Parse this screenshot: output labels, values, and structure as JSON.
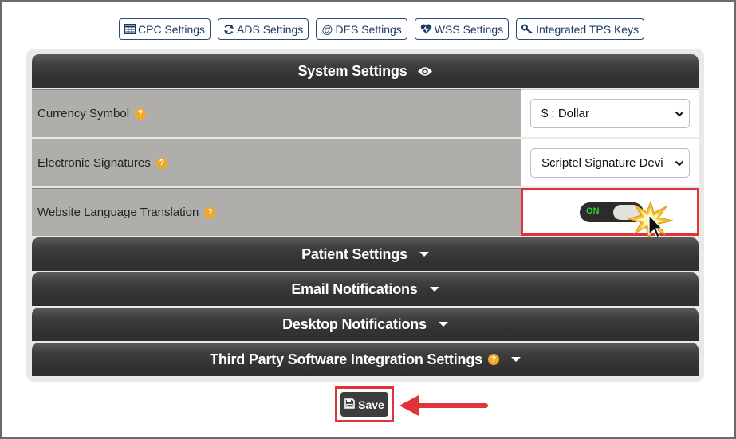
{
  "tabs": [
    {
      "label": "CPC Settings",
      "icon": "table-icon"
    },
    {
      "label": "ADS Settings",
      "icon": "sync-icon"
    },
    {
      "label": "DES Settings",
      "icon": "at-icon"
    },
    {
      "label": "WSS Settings",
      "icon": "heartbeat-icon"
    },
    {
      "label": "Integrated TPS Keys",
      "icon": "key-icon"
    }
  ],
  "system_settings": {
    "title": "System Settings",
    "rows": [
      {
        "label": "Currency Symbol",
        "value": "$ : Dollar"
      },
      {
        "label": "Electronic Signatures",
        "value": "Scriptel Signature Devi"
      },
      {
        "label": "Website Language Translation",
        "toggle": "ON"
      }
    ]
  },
  "sections": [
    {
      "title": "Patient Settings"
    },
    {
      "title": "Email Notifications"
    },
    {
      "title": "Desktop Notifications"
    },
    {
      "title": "Third Party Software Integration Settings"
    }
  ],
  "save_label": "Save",
  "help_glyph": "?",
  "colors": {
    "bar_dark": "#333333",
    "label_bg": "#b0aeab",
    "help_orange": "#f0a825",
    "highlight_red": "#e0343a",
    "toggle_on_green": "#33cc33",
    "tab_blue": "#1e3a66"
  }
}
